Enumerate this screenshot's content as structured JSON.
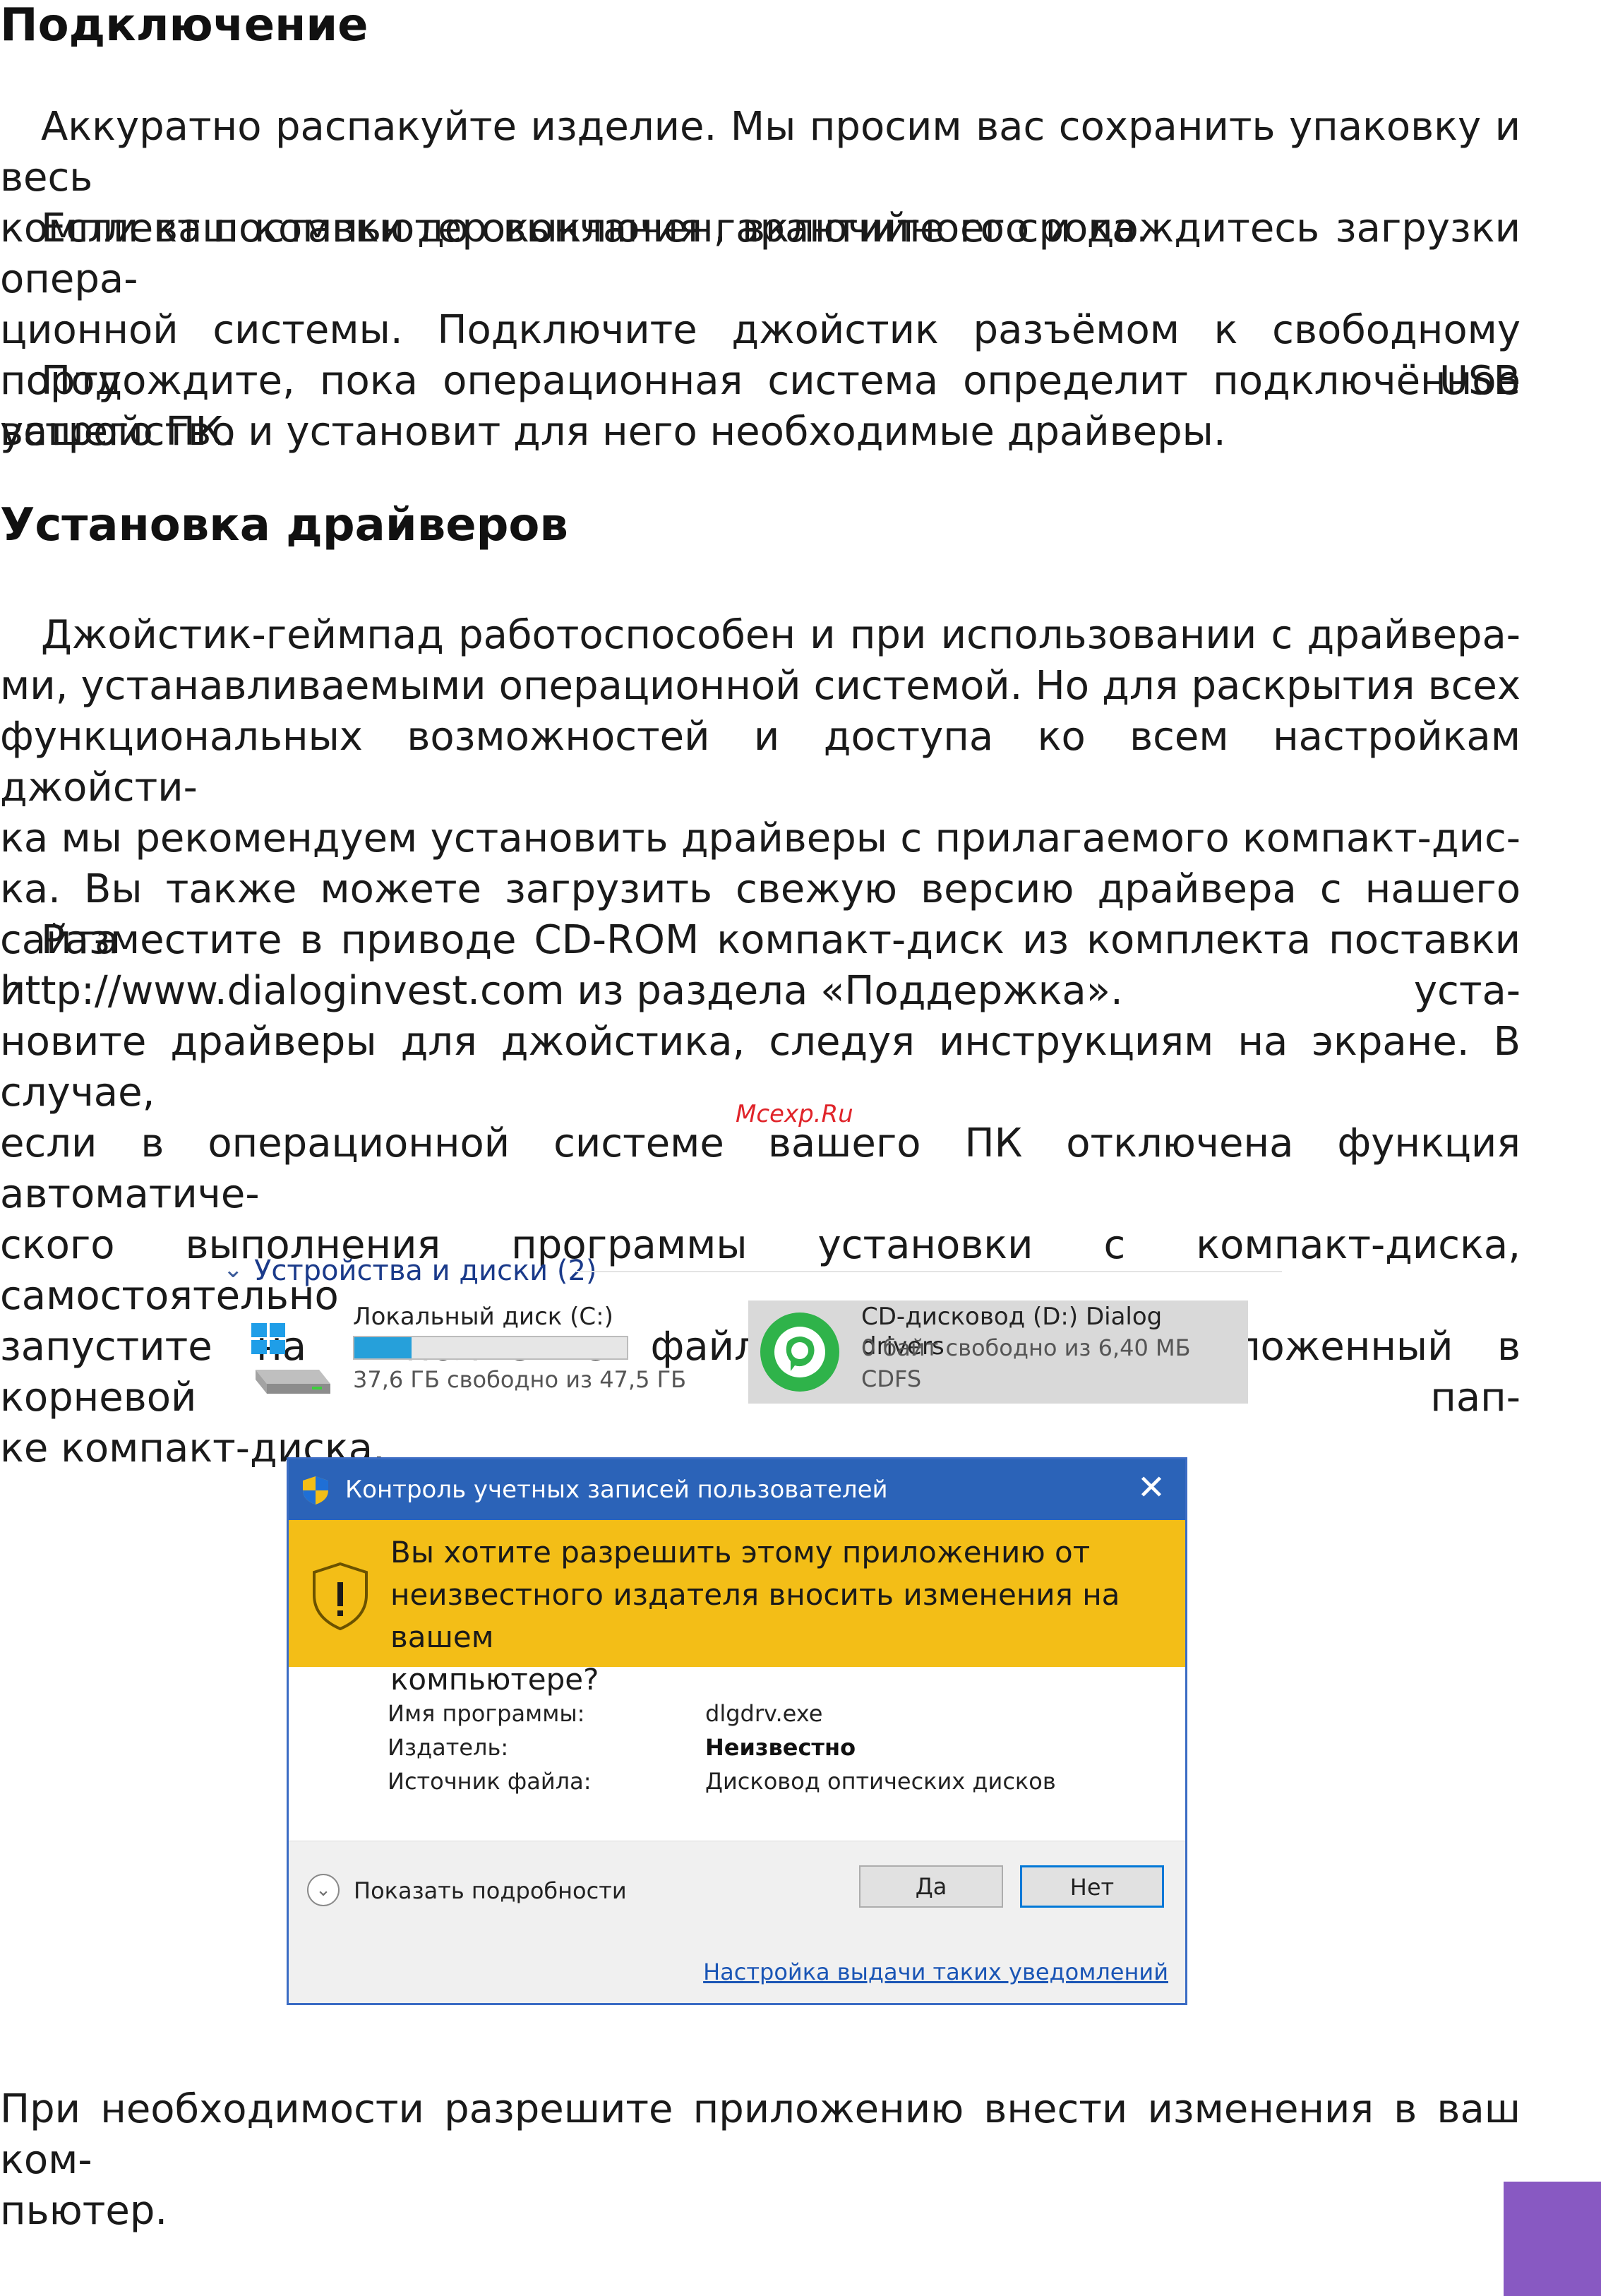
{
  "section1": {
    "heading": "Подключение",
    "p1": [
      "Аккуратно распакуйте изделие. Мы просим вас сохранить упаковку и весь",
      "комплект поставки до окончания гарантийного срока."
    ],
    "p2": [
      "Если ваш компьютер выключен, включите его и дождитесь загрузки опера-",
      "ционной системы. Подключите джойстик разъёмом к свободному порту USB",
      "вашего ПК."
    ],
    "p3": [
      "Подождите, пока операционная система определит подключённое",
      "устройство и установит для него необходимые драйверы."
    ]
  },
  "section2": {
    "heading": "Установка драйверов",
    "p1": [
      "Джойстик-геймпад работоспособен и при использовании с драйвера-",
      "ми, устанавливаемыми операционной системой. Но для раскрытия всех",
      "функциональных возможностей и доступа ко всем настройкам джойсти-",
      "ка мы рекомендуем установить драйверы с прилагаемого компакт-дис-",
      "ка. Вы также можете загрузить свежую версию драйвера с нашего сайта",
      "http://www.dialoginvest.com из раздела «Поддержка»."
    ],
    "p2": [
      "Разместите в приводе CD-ROM компакт-диск из комплекта поставки и уста-",
      "новите драйверы для джойстика, следуя инструкциям на экране. В случае,",
      "если в операционной системе вашего ПК отключена функция автоматиче-",
      "ского выполнения программы установки с компакт-диска, самостоятельно",
      "запустите на выполнение файл «dlgdrv.exe», расположенный в корневой пап-",
      "ке компакт-диска."
    ]
  },
  "watermark": "Mcexp.Ru",
  "explorer": {
    "group_header": "Устройства и диски (2)",
    "drive_c": {
      "name": "Локальный диск (C:)",
      "free": "37,6 ГБ свободно из 47,5 ГБ",
      "used_fraction": 0.21,
      "bar_color": "#26a0da"
    },
    "drive_d": {
      "name": "CD-дисковод (D:) Dialog drivers",
      "free": "0 байт свободно из 6,40 МБ",
      "fs": "CDFS",
      "icon_color": "#2fb34a"
    }
  },
  "uac": {
    "title": "Контроль учетных записей пользователей",
    "close_glyph": "✕",
    "question": [
      "Вы хотите разрешить этому приложению от",
      "неизвестного издателя вносить изменения на вашем",
      "компьютере?"
    ],
    "rows": [
      {
        "key": "Имя программы:",
        "value": "dlgdrv.exe"
      },
      {
        "key": "Издатель:",
        "value": "Неизвестно"
      },
      {
        "key": "Источник файла:",
        "value": "Дисковод оптических дисков"
      }
    ],
    "details_label": "Показать подробности",
    "yes_label": "Да",
    "no_label": "Нет",
    "settings_link": "Настройка выдачи таких уведомлений",
    "colors": {
      "titlebar": "#2b63b8",
      "banner": "#f3be17"
    }
  },
  "section3": {
    "p1": [
      "При необходимости разрешите приложению внести изменения в ваш ком-",
      "пьютер."
    ]
  }
}
